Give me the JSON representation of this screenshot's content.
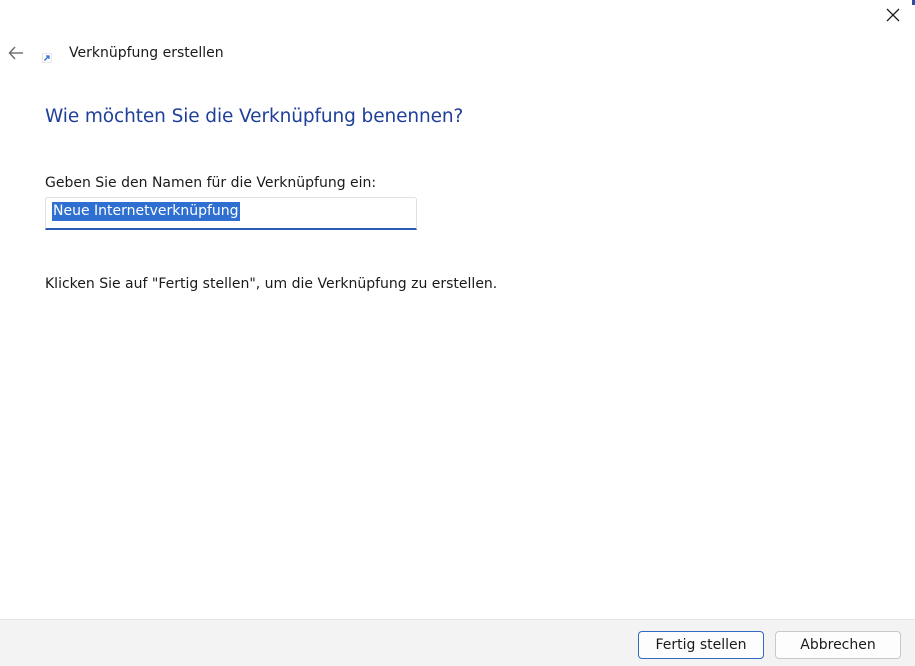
{
  "window": {
    "title": "Verknüpfung erstellen",
    "close_label": "×",
    "back_label": "←"
  },
  "page": {
    "heading": "Wie möchten Sie die Verknüpfung benennen?",
    "field_label": "Geben Sie den Namen für die Verknüpfung ein:",
    "name_value": "Neue Internetverknüpfung",
    "hint": "Klicken Sie auf \"Fertig stellen\", um die Verknüpfung zu erstellen."
  },
  "footer": {
    "finish_label": "Fertig stellen",
    "cancel_label": "Abbrechen"
  },
  "colors": {
    "heading": "#1f3f9a",
    "accent": "#2f6fd1",
    "footer_bg": "#f3f3f3"
  },
  "icons": {
    "close": "close-icon",
    "back": "back-arrow-icon",
    "shortcut": "shortcut-arrow-icon"
  }
}
